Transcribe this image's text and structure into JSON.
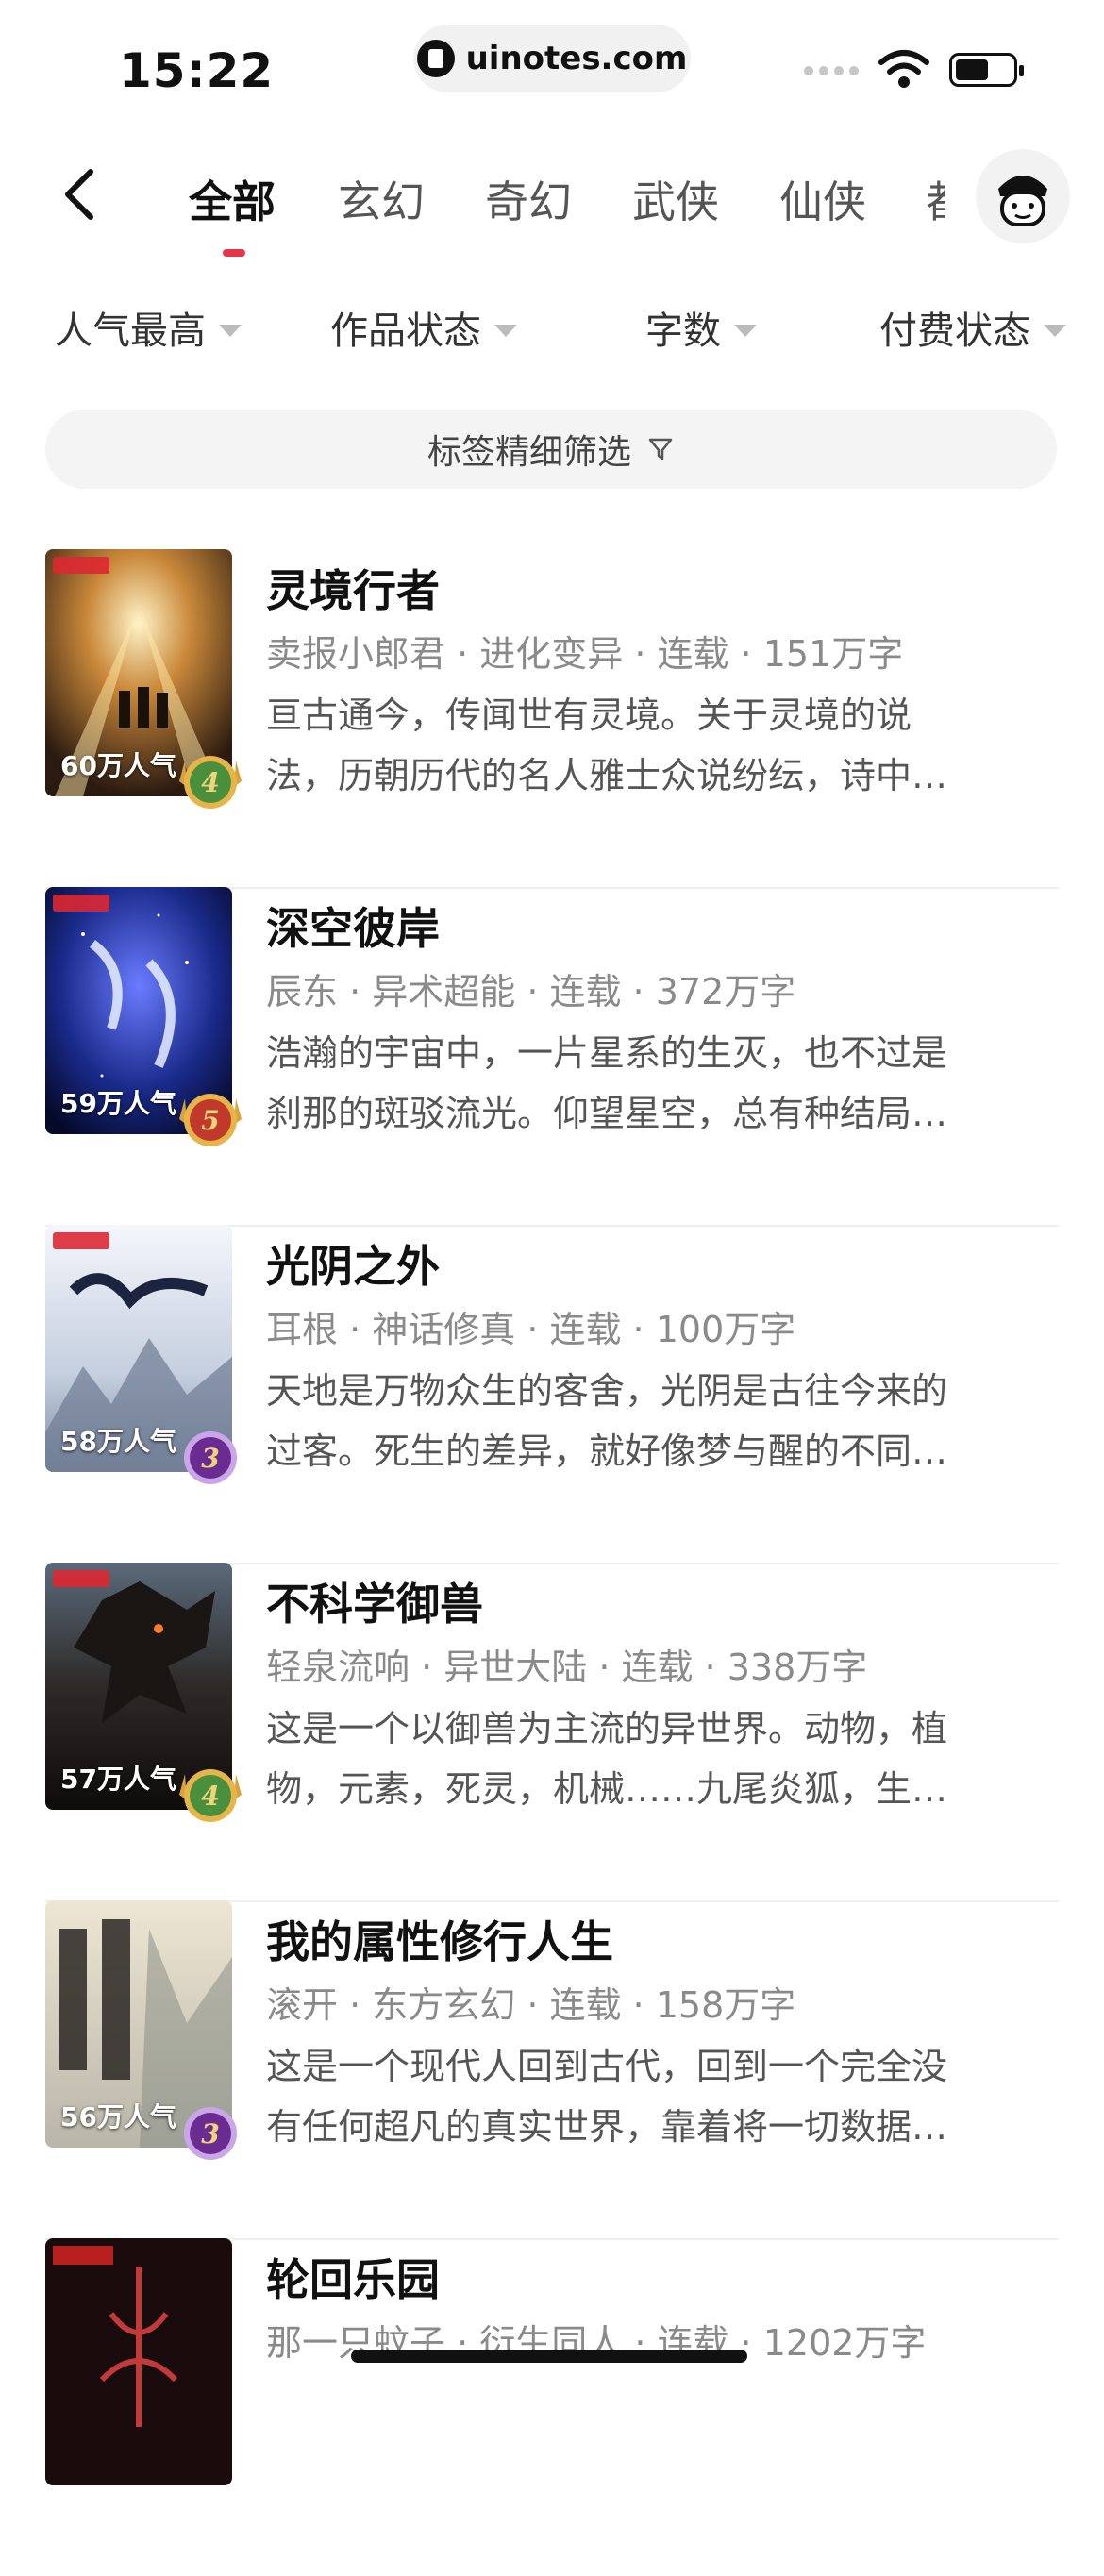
{
  "status_bar": {
    "time": "15:22",
    "url": "uinotes.com"
  },
  "nav": {
    "tabs": [
      {
        "label": "全部"
      },
      {
        "label": "玄幻"
      },
      {
        "label": "奇幻"
      },
      {
        "label": "武侠"
      },
      {
        "label": "仙侠"
      },
      {
        "label": "都"
      }
    ],
    "active_tab_index": 0
  },
  "filters": [
    {
      "label": "人气最高"
    },
    {
      "label": "作品状态"
    },
    {
      "label": "字数"
    },
    {
      "label": "付费状态"
    }
  ],
  "tag_filter": {
    "label": "标签精细筛选"
  },
  "colors": {
    "accent": "#e8344a",
    "meta": "#8a8a8a",
    "desc": "#555555"
  },
  "books": [
    {
      "title": "灵境行者",
      "meta": "卖报小郎君 · 进化变异 · 连载 · 151万字",
      "desc_line1": "亘古通今，传闻世有灵境。关于灵境的说",
      "desc_line2": "法，历朝历代的名人雅士众说纷纭，诗中…",
      "popularity": "60万人气",
      "rank": "4",
      "rank_tier": "gold",
      "cover_theme": "lights"
    },
    {
      "title": "深空彼岸",
      "meta": "辰东 · 异术超能 · 连载 · 372万字",
      "desc_line1": "浩瀚的宇宙中，一片星系的生灭，也不过是",
      "desc_line2": "刹那的斑驳流光。仰望星空，总有种结局…",
      "popularity": "59万人气",
      "rank": "5",
      "rank_tier": "gold",
      "cover_theme": "space"
    },
    {
      "title": "光阴之外",
      "meta": "耳根 · 神话修真 · 连载 · 100万字",
      "desc_line1": "天地是万物众生的客舍，光阴是古往今来的",
      "desc_line2": "过客。死生的差异，就好像梦与醒的不同…",
      "popularity": "58万人气",
      "rank": "3",
      "rank_tier": "purple",
      "cover_theme": "mountain"
    },
    {
      "title": "不科学御兽",
      "meta": "轻泉流响 · 异世大陆 · 连载 · 338万字",
      "desc_line1": "这是一个以御兽为主流的异世界。动物，植",
      "desc_line2": "物，元素，死灵，机械……九尾炎狐，生…",
      "popularity": "57万人气",
      "rank": "4",
      "rank_tier": "gold",
      "cover_theme": "dragon"
    },
    {
      "title": "我的属性修行人生",
      "meta": "滚开 · 东方玄幻 · 连载 · 158万字",
      "desc_line1": "这是一个现代人回到古代，回到一个完全没",
      "desc_line2": "有任何超凡的真实世界，靠着将一切数据…",
      "popularity": "56万人气",
      "rank": "3",
      "rank_tier": "purple",
      "cover_theme": "paper"
    },
    {
      "title": "轮回乐园",
      "meta": "那一只蚊子 · 衍生同人 · 连载 · 1202万字",
      "desc_line1": "",
      "desc_line2": "",
      "popularity": "",
      "rank": "",
      "rank_tier": "",
      "cover_theme": "dark-red"
    }
  ],
  "icons": {
    "back": "chevron-left-icon",
    "profile": "avatar-icon",
    "filter": "funnel-icon",
    "dropdown": "caret-down-icon"
  }
}
